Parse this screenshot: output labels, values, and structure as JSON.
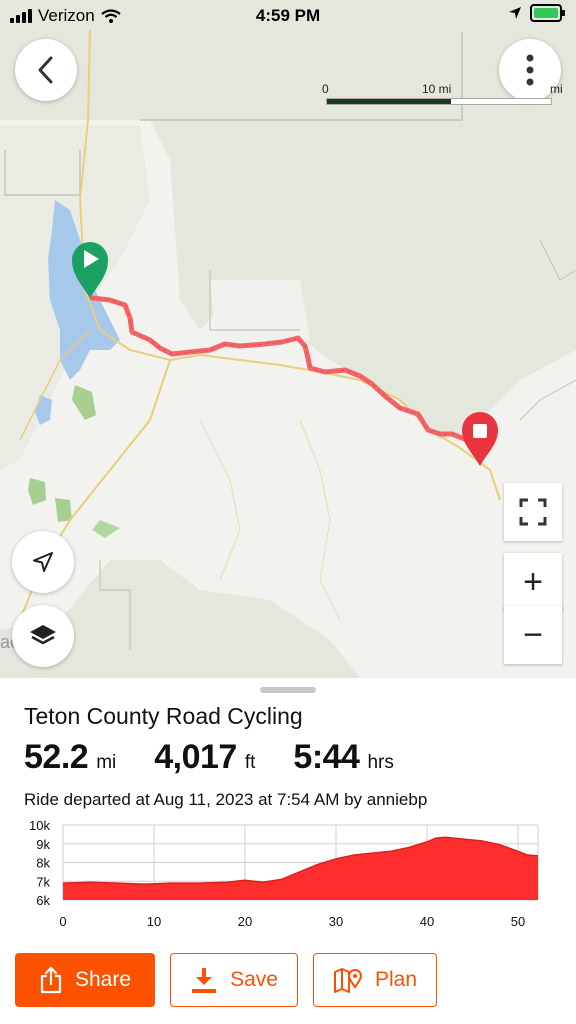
{
  "status_bar": {
    "carrier": "Verizon",
    "time": "4:59 PM"
  },
  "map": {
    "scale": {
      "label_start": "0",
      "label_mid": "10 mi",
      "label_end": "mi"
    },
    "buttons": {
      "back": "back-icon",
      "more": "more-vertical-icon",
      "fullscreen": "fullscreen-icon",
      "zoom_in": "+",
      "zoom_out": "−",
      "locate": "location-arrow-icon",
      "layers": "layers-icon"
    },
    "route_color": "#f4656a",
    "start_marker_color": "#1aa061",
    "end_marker_color": "#e8343e",
    "partial_label": "ac"
  },
  "activity": {
    "title": "Teton County Road Cycling",
    "distance": {
      "value": "52.2",
      "unit": "mi"
    },
    "elevation": {
      "value": "4,017",
      "unit": "ft"
    },
    "time": {
      "value": "5:44",
      "unit": "hrs"
    },
    "subtitle": "Ride departed at Aug 11, 2023 at 7:54 AM by anniebp"
  },
  "chart_data": {
    "type": "area",
    "title": "",
    "xlabel": "",
    "ylabel": "",
    "x_ticks": [
      "0",
      "10",
      "20",
      "30",
      "40",
      "50"
    ],
    "y_ticks": [
      "10k",
      "9k",
      "8k",
      "7k",
      "6k"
    ],
    "xlim": [
      0,
      52.2
    ],
    "ylim": [
      6000,
      10000
    ],
    "grid": true,
    "color": "#ff2e2e",
    "x": [
      0,
      3,
      6,
      9,
      12,
      15,
      18,
      20,
      22,
      24,
      26,
      28,
      30,
      32,
      34,
      36,
      38,
      40,
      41,
      42,
      44,
      46,
      48,
      50,
      51,
      52.2
    ],
    "y": [
      6900,
      6950,
      6900,
      6850,
      6900,
      6900,
      6950,
      7050,
      6950,
      7100,
      7500,
      7900,
      8200,
      8400,
      8500,
      8600,
      8800,
      9100,
      9300,
      9350,
      9250,
      9150,
      8950,
      8600,
      8400,
      8350
    ]
  },
  "actions": {
    "share": {
      "label": "Share",
      "icon": "share-icon"
    },
    "save": {
      "label": "Save",
      "icon": "download-icon"
    },
    "plan": {
      "label": "Plan",
      "icon": "map-pin-icon"
    }
  }
}
